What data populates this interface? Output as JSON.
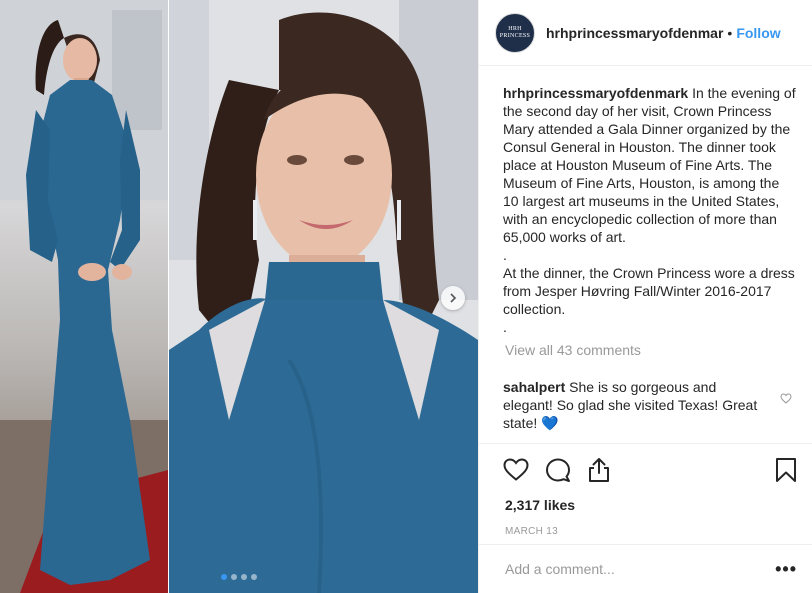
{
  "post": {
    "username": "hrhprincessmaryofdenmar",
    "separator": "•",
    "follow_label": "Follow",
    "avatar_text": "HRH PRINCESS"
  },
  "caption": {
    "username": "hrhprincessmaryofdenmark",
    "text_1": "In the evening of the second day of her visit, Crown Princess Mary attended a Gala Dinner organized by the Consul General in Houston. The dinner took place at Houston Museum of Fine Arts. The Museum of Fine Arts, Houston, is among the 10 largest art museums in the United States, with an encyclopedic collection of more than 65,000 works of art.",
    "dot_1": ".",
    "text_2": "At the dinner, the Crown Princess wore a dress from Jesper Høvring Fall/Winter 2016-2017 collection.",
    "dot_2": "."
  },
  "comments": {
    "view_all": "View all 43 comments",
    "items": [
      {
        "username": "sahalpert",
        "text": "She is so gorgeous and elegant! So glad she visited Texas! Great state! 💙"
      }
    ]
  },
  "stats": {
    "likes": "2,317 likes",
    "date": "MARCH 13"
  },
  "add_comment": {
    "placeholder": "Add a comment...",
    "more": "•••"
  },
  "carousel": {
    "slide_count": 4,
    "active_index": 0
  },
  "colors": {
    "accent": "#3897f0",
    "dress_blue": "#2a6791",
    "carpet_red": "#9b1c1f",
    "text": "#262626",
    "muted": "#999999"
  },
  "icons": [
    "heart-icon",
    "comment-icon",
    "share-icon",
    "bookmark-icon",
    "chevron-right-icon",
    "small-heart-icon"
  ]
}
